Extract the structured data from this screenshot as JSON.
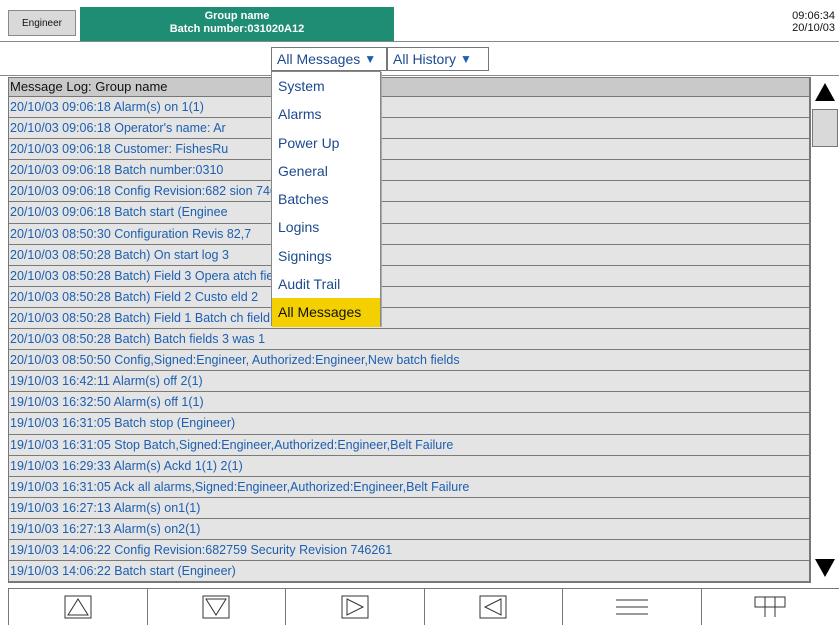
{
  "header": {
    "user": "Engineer",
    "group_name": "Group name",
    "batch_number": "Batch number:031020A12",
    "time": "09:06:34",
    "date": "20/10/03"
  },
  "filters": {
    "messages": "All Messages",
    "history": "All History"
  },
  "log": {
    "title": "Message Log: Group name",
    "rows": [
      "20/10/03 09:06:18 Alarm(s) on 1(1)",
      "20/10/03 09:06:18 Operator's name: Ar",
      "20/10/03 09:06:18 Customer: FishesRu",
      "20/10/03 09:06:18 Batch number:0310",
      "20/10/03 09:06:18 Config Revision:682                     sion 746261",
      "20/10/03 09:06:18 Batch start (Enginee",
      "20/10/03 08:50:30 Configuration Revis                     82,7",
      "20/10/03 08:50:28 Batch) On start log 3",
      "20/10/03 08:50:28 Batch) Field 3 Opera                    atch field 3",
      "20/10/03 08:50:28 Batch) Field 2 Custo                    eld 2",
      "20/10/03 08:50:28 Batch) Field 1 Batch                    ch field 1",
      "20/10/03 08:50:28 Batch) Batch fields 3 was 1",
      "20/10/03 08:50:50 Config,Signed:Engineer, Authorized:Engineer,New batch fields",
      "19/10/03 16:42:11 Alarm(s) off 2(1)",
      "19/10/03 16:32:50 Alarm(s) off 1(1)",
      "19/10/03 16:31:05 Batch stop (Engineer)",
      "19/10/03 16:31:05 Stop Batch,Signed:Engineer,Authorized:Engineer,Belt Failure",
      "19/10/03 16:29:33 Alarm(s) Ackd 1(1) 2(1)",
      "19/10/03 16:31:05 Ack all alarms,Signed:Engineer,Authorized:Engineer,Belt Failure",
      "19/10/03 16:27:13 Alarm(s) on1(1)",
      "19/10/03 16:27:13 Alarm(s) on2(1)",
      "19/10/03 14:06:22 Config Revision:682759 Security Revision 746261",
      "19/10/03 14:06:22 Batch start (Engineer)",
      ""
    ]
  },
  "dropdown": {
    "items": [
      "System",
      "Alarms",
      "Power Up",
      "General",
      "Batches",
      "Logins",
      "Signings",
      "Audit Trail",
      "All Messages"
    ],
    "selected": "All Messages"
  },
  "toolbar": {
    "icons": [
      "triangle-up-icon",
      "triangle-down-icon",
      "triangle-right-icon",
      "triangle-left-icon",
      "menu-lines-icon",
      "grid-icon"
    ]
  },
  "colors": {
    "banner": "#1f8c74",
    "text_blue": "#1d5fb0",
    "highlight": "#f5d000",
    "row_bg": "#e4e4e4"
  }
}
